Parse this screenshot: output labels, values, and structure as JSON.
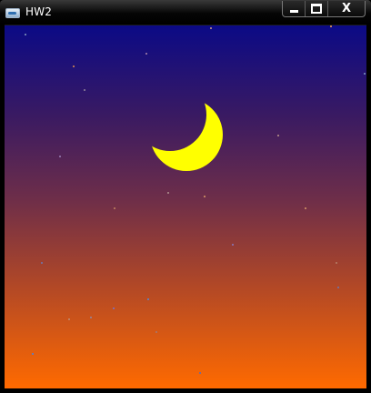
{
  "window": {
    "title": "HW2",
    "icon": "app-icon",
    "controls": {
      "minimize_icon": "minimize-icon",
      "maximize_icon": "maximize-icon",
      "close_glyph": "X"
    }
  },
  "scene": {
    "sky_colors": {
      "top": "#0b0a86",
      "upper_mid": "#3a1a62",
      "mid": "#6e2e49",
      "lower_mid": "#b24826",
      "bottom": "#ff6a00"
    },
    "moon_color": "#ffff00",
    "moon_shape": "crescent",
    "star_count": 24
  }
}
